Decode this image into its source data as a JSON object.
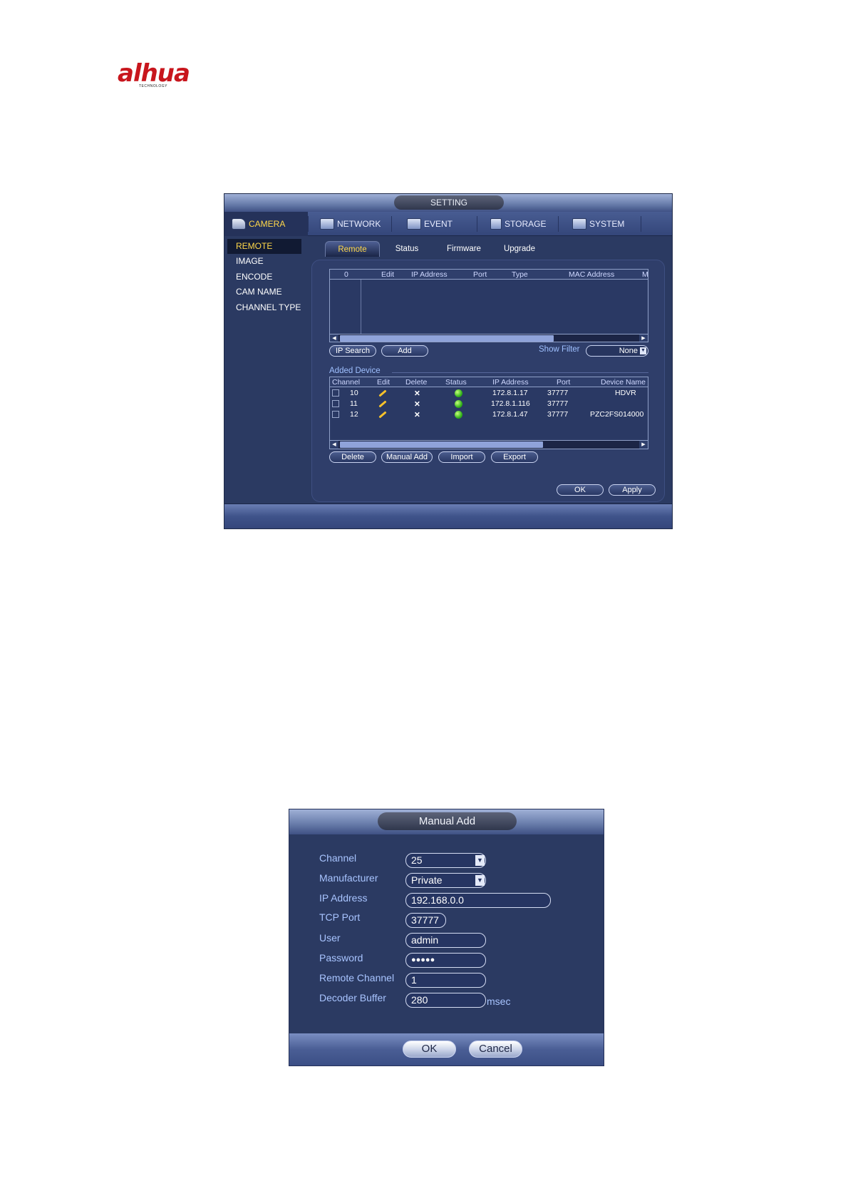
{
  "logo": {
    "brand": "alhua",
    "tagline": "TECHNOLOGY"
  },
  "setting_window": {
    "title": "SETTING",
    "top_tabs": [
      {
        "label": "CAMERA",
        "icon": "camera-icon",
        "active": true
      },
      {
        "label": "NETWORK",
        "icon": "network-icon",
        "active": false
      },
      {
        "label": "EVENT",
        "icon": "event-icon",
        "active": false
      },
      {
        "label": "STORAGE",
        "icon": "storage-icon",
        "active": false
      },
      {
        "label": "SYSTEM",
        "icon": "system-icon",
        "active": false
      }
    ],
    "side_menu": [
      {
        "label": "REMOTE",
        "active": true
      },
      {
        "label": "IMAGE",
        "active": false
      },
      {
        "label": "ENCODE",
        "active": false
      },
      {
        "label": "CAM NAME",
        "active": false
      },
      {
        "label": "CHANNEL TYPE",
        "active": false
      }
    ],
    "sub_tabs": [
      {
        "label": "Remote",
        "active": true
      },
      {
        "label": "Status",
        "active": false
      },
      {
        "label": "Firmware",
        "active": false
      },
      {
        "label": "Upgrade",
        "active": false
      }
    ],
    "search_table": {
      "headers": [
        "0",
        "Edit",
        "IP Address",
        "Port",
        "Type",
        "MAC Address",
        "M"
      ]
    },
    "search_buttons": {
      "ip_search": "IP Search",
      "add": "Add"
    },
    "show_filter": {
      "label": "Show Filter",
      "value": "None"
    },
    "added_device": {
      "label": "Added Device",
      "headers": [
        "Channel",
        "Edit",
        "Delete",
        "Status",
        "IP Address",
        "Port",
        "Device Name"
      ],
      "rows": [
        {
          "channel": "10",
          "ip": "172.8.1.17",
          "port": "37777",
          "name": "HDVR"
        },
        {
          "channel": "11",
          "ip": "172.8.1.116",
          "port": "37777",
          "name": ""
        },
        {
          "channel": "12",
          "ip": "172.8.1.47",
          "port": "37777",
          "name": "PZC2FS014000"
        }
      ]
    },
    "device_buttons": {
      "delete": "Delete",
      "manual_add": "Manual Add",
      "import": "Import",
      "export": "Export"
    },
    "footer_buttons": {
      "ok": "OK",
      "apply": "Apply"
    },
    "colors": {
      "accent": "#ffd84a",
      "panel": "#2b3a62",
      "status_online": "#35b51d",
      "delete_red": "#ff3b2f"
    }
  },
  "manual_add": {
    "title": "Manual Add",
    "fields": {
      "channel": {
        "label": "Channel",
        "value": "25"
      },
      "manufacturer": {
        "label": "Manufacturer",
        "value": "Private"
      },
      "ip_address": {
        "label": "IP Address",
        "value": "192.168.0.0"
      },
      "tcp_port": {
        "label": "TCP Port",
        "value": "37777"
      },
      "user": {
        "label": "User",
        "value": "admin"
      },
      "password": {
        "label": "Password",
        "value": "●●●●●"
      },
      "remote_channel": {
        "label": "Remote Channel",
        "value": "1"
      },
      "decoder_buffer": {
        "label": "Decoder Buffer",
        "value": "280",
        "unit": "msec"
      }
    },
    "buttons": {
      "ok": "OK",
      "cancel": "Cancel"
    }
  }
}
